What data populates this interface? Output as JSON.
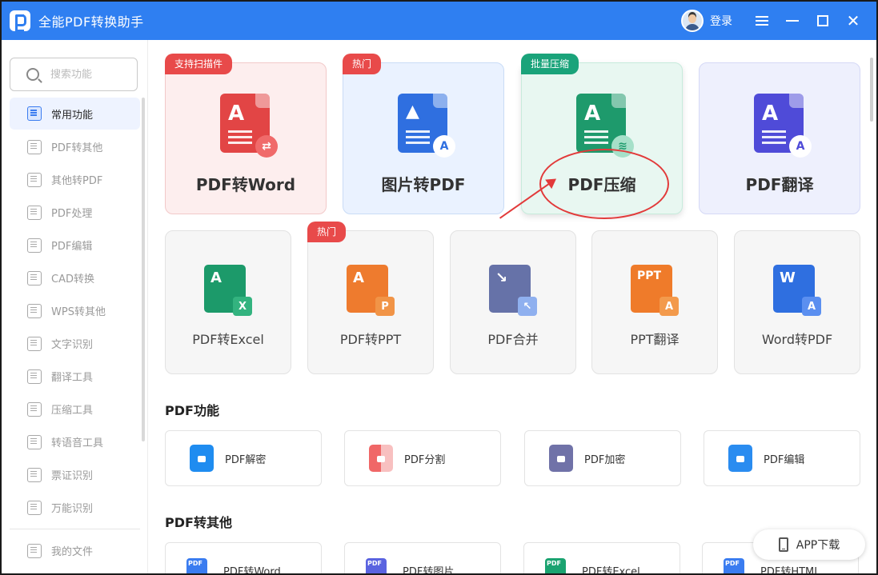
{
  "app": {
    "title": "全能PDF转换助手",
    "login": "登录"
  },
  "search": {
    "placeholder": "搜索功能"
  },
  "sidebar": {
    "items": [
      {
        "label": "常用功能",
        "icon": "grid-icon",
        "active": true
      },
      {
        "label": "PDF转其他",
        "icon": "pdf-convert-icon"
      },
      {
        "label": "其他转PDF",
        "icon": "to-pdf-icon"
      },
      {
        "label": "PDF处理",
        "icon": "pdf-process-icon"
      },
      {
        "label": "PDF编辑",
        "icon": "pdf-edit-icon"
      },
      {
        "label": "CAD转换",
        "icon": "cad-icon"
      },
      {
        "label": "WPS转其他",
        "icon": "wps-icon"
      },
      {
        "label": "文字识别",
        "icon": "ocr-icon"
      },
      {
        "label": "翻译工具",
        "icon": "translate-icon"
      },
      {
        "label": "压缩工具",
        "icon": "compress-icon"
      },
      {
        "label": "转语音工具",
        "icon": "speech-icon"
      },
      {
        "label": "票证识别",
        "icon": "ticket-icon"
      },
      {
        "label": "万能识别",
        "icon": "scan-icon"
      }
    ],
    "my_files": "我的文件"
  },
  "featured": [
    {
      "label": "PDF转Word",
      "ribbon": "支持扫描件",
      "ribbon_color": "#e84a4a",
      "bg": "#fdeeee",
      "border": "#f2c9c9",
      "icon_color": "#e24545",
      "badge_glyph": "⇄",
      "badge_color": "#e24545"
    },
    {
      "label": "图片转PDF",
      "ribbon": "热门",
      "ribbon_color": "#e84a4a",
      "bg": "#eaf2ff",
      "border": "#c9dcf6",
      "icon_color": "#2f6fe0",
      "badge_glyph": "A",
      "badge_color": "#2f6fe0"
    },
    {
      "label": "PDF压缩",
      "ribbon": "批量压缩",
      "ribbon_color": "#1aa37a",
      "bg": "#e8f7f1",
      "border": "#c7ebdc",
      "icon_color": "#1e9a6c",
      "badge_glyph": "≋",
      "badge_color": "#1e9a6c"
    },
    {
      "label": "PDF翻译",
      "ribbon": "",
      "ribbon_color": "",
      "bg": "#eef0fd",
      "border": "#d5d9f6",
      "icon_color": "#4f4bd8",
      "badge_glyph": "A",
      "badge_color": "#4f4bd8"
    }
  ],
  "tools": [
    {
      "label": "PDF转Excel",
      "ribbon": "",
      "icon_color": "#1c9a6a",
      "badge": "X",
      "badge_color": "#33b37f"
    },
    {
      "label": "PDF转PPT",
      "ribbon": "热门",
      "icon_color": "#ee7b2e",
      "badge": "P",
      "badge_color": "#f19447"
    },
    {
      "label": "PDF合并",
      "ribbon": "",
      "icon_color": "#6672a8",
      "badge": "↖",
      "badge_color": "#8fb0ef"
    },
    {
      "label": "PPT翻译",
      "ribbon": "",
      "icon_color": "#ef7b2a",
      "badge": "A",
      "badge_color": "#f39a4c",
      "glyph": "PPT"
    },
    {
      "label": "Word转PDF",
      "ribbon": "",
      "icon_color": "#2f6fe0",
      "badge": "A",
      "badge_color": "#5b8ff0",
      "glyph": "W"
    }
  ],
  "sections": {
    "pdf_functions": {
      "title": "PDF功能",
      "items": [
        {
          "label": "PDF解密",
          "color": "#1f8cf0"
        },
        {
          "label": "PDF分割",
          "color": "#f06767"
        },
        {
          "label": "PDF加密",
          "color": "#7072a8"
        },
        {
          "label": "PDF编辑",
          "color": "#2a8cf0"
        }
      ]
    },
    "pdf_to_other": {
      "title": "PDF转其他",
      "items": [
        {
          "label": "PDF转Word",
          "color": "#3a7cf0"
        },
        {
          "label": "PDF转图片",
          "color": "#5a63e0"
        },
        {
          "label": "PDF转Excel",
          "color": "#1aa370"
        },
        {
          "label": "PDF转HTML",
          "color": "#3a7cf0"
        }
      ]
    }
  },
  "app_download": "APP下载"
}
